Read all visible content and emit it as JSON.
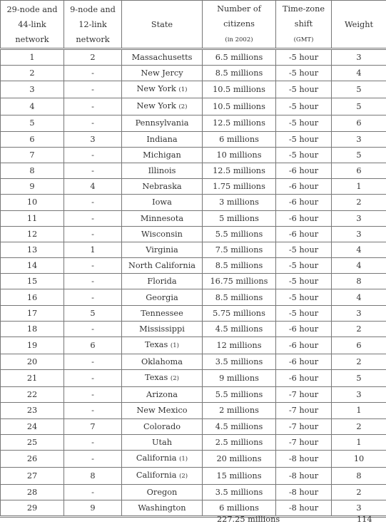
{
  "headers": {
    "col1": [
      "29-node and",
      "44-link",
      "network"
    ],
    "col2": [
      "9-node and",
      "12-link",
      "network"
    ],
    "col3": "State",
    "col4": [
      "Number of",
      "citizens",
      "(in 2002)"
    ],
    "col5": [
      "Time-zone",
      "shift",
      "(GMT)"
    ],
    "col6": "Weight"
  },
  "rows": [
    {
      "n29": "1",
      "n9": "2",
      "state": "Massachusetts",
      "note": "",
      "citizens": "6.5 millions",
      "tz": "-5 hour",
      "weight": "3"
    },
    {
      "n29": "2",
      "n9": "-",
      "state": "New Jercy",
      "note": "",
      "citizens": "8.5 millions",
      "tz": "-5 hour",
      "weight": "4"
    },
    {
      "n29": "3",
      "n9": "-",
      "state": "New York",
      "note": "(1)",
      "citizens": "10.5 millions",
      "tz": "-5 hour",
      "weight": "5"
    },
    {
      "n29": "4",
      "n9": "-",
      "state": "New York",
      "note": "(2)",
      "citizens": "10.5 millions",
      "tz": "-5 hour",
      "weight": "5"
    },
    {
      "n29": "5",
      "n9": "-",
      "state": "Pennsylvania",
      "note": "",
      "citizens": "12.5 millions",
      "tz": "-5 hour",
      "weight": "6"
    },
    {
      "n29": "6",
      "n9": "3",
      "state": "Indiana",
      "note": "",
      "citizens": "6 millions",
      "tz": "-5 hour",
      "weight": "3"
    },
    {
      "n29": "7",
      "n9": "-",
      "state": "Michigan",
      "note": "",
      "citizens": "10 millions",
      "tz": "-5 hour",
      "weight": "5"
    },
    {
      "n29": "8",
      "n9": "-",
      "state": "Illinois",
      "note": "",
      "citizens": "12.5 millions",
      "tz": "-6 hour",
      "weight": "6"
    },
    {
      "n29": "9",
      "n9": "4",
      "state": "Nebraska",
      "note": "",
      "citizens": "1.75 millions",
      "tz": "-6 hour",
      "weight": "1"
    },
    {
      "n29": "10",
      "n9": "-",
      "state": "Iowa",
      "note": "",
      "citizens": "3 millions",
      "tz": "-6 hour",
      "weight": "2"
    },
    {
      "n29": "11",
      "n9": "-",
      "state": "Minnesota",
      "note": "",
      "citizens": "5 millions",
      "tz": "-6 hour",
      "weight": "3"
    },
    {
      "n29": "12",
      "n9": "-",
      "state": "Wisconsin",
      "note": "",
      "citizens": "5.5 millions",
      "tz": "-6 hour",
      "weight": "3"
    },
    {
      "n29": "13",
      "n9": "1",
      "state": "Virginia",
      "note": "",
      "citizens": "7.5 millions",
      "tz": "-5 hour",
      "weight": "4"
    },
    {
      "n29": "14",
      "n9": "-",
      "state": "North California",
      "note": "",
      "citizens": "8.5 millions",
      "tz": "-5 hour",
      "weight": "4"
    },
    {
      "n29": "15",
      "n9": "-",
      "state": "Florida",
      "note": "",
      "citizens": "16.75 millions",
      "tz": "-5 hour",
      "weight": "8"
    },
    {
      "n29": "16",
      "n9": "-",
      "state": "Georgia",
      "note": "",
      "citizens": "8.5 millions",
      "tz": "-5 hour",
      "weight": "4"
    },
    {
      "n29": "17",
      "n9": "5",
      "state": "Tennessee",
      "note": "",
      "citizens": "5.75 millions",
      "tz": "-5 hour",
      "weight": "3"
    },
    {
      "n29": "18",
      "n9": "-",
      "state": "Mississippi",
      "note": "",
      "citizens": "4.5 millions",
      "tz": "-6 hour",
      "weight": "2"
    },
    {
      "n29": "19",
      "n9": "6",
      "state": "Texas",
      "note": "(1)",
      "citizens": "12 millions",
      "tz": "-6 hour",
      "weight": "6"
    },
    {
      "n29": "20",
      "n9": "-",
      "state": "Oklahoma",
      "note": "",
      "citizens": "3.5 millions",
      "tz": "-6 hour",
      "weight": "2"
    },
    {
      "n29": "21",
      "n9": "-",
      "state": "Texas",
      "note": "(2)",
      "citizens": "9 millions",
      "tz": "-6 hour",
      "weight": "5"
    },
    {
      "n29": "22",
      "n9": "-",
      "state": "Arizona",
      "note": "",
      "citizens": "5.5 millions",
      "tz": "-7 hour",
      "weight": "3"
    },
    {
      "n29": "23",
      "n9": "-",
      "state": "New Mexico",
      "note": "",
      "citizens": "2 millions",
      "tz": "-7 hour",
      "weight": "1"
    },
    {
      "n29": "24",
      "n9": "7",
      "state": "Colorado",
      "note": "",
      "citizens": "4.5 millions",
      "tz": "-7 hour",
      "weight": "2"
    },
    {
      "n29": "25",
      "n9": "-",
      "state": "Utah",
      "note": "",
      "citizens": "2.5 millions",
      "tz": "-7 hour",
      "weight": "1"
    },
    {
      "n29": "26",
      "n9": "-",
      "state": "California",
      "note": "(1)",
      "citizens": "20 millions",
      "tz": "-8 hour",
      "weight": "10"
    },
    {
      "n29": "27",
      "n9": "8",
      "state": "California",
      "note": "(2)",
      "citizens": "15 millions",
      "tz": "-8 hour",
      "weight": "8"
    },
    {
      "n29": "28",
      "n9": "-",
      "state": "Oregon",
      "note": "",
      "citizens": "3.5 millions",
      "tz": "-8 hour",
      "weight": "2"
    },
    {
      "n29": "29",
      "n9": "9",
      "state": "Washington",
      "note": "",
      "citizens": "6 millions",
      "tz": "-8 hour",
      "weight": "3"
    }
  ],
  "totals": {
    "citizens": "227.25 millions",
    "weight": "114"
  }
}
